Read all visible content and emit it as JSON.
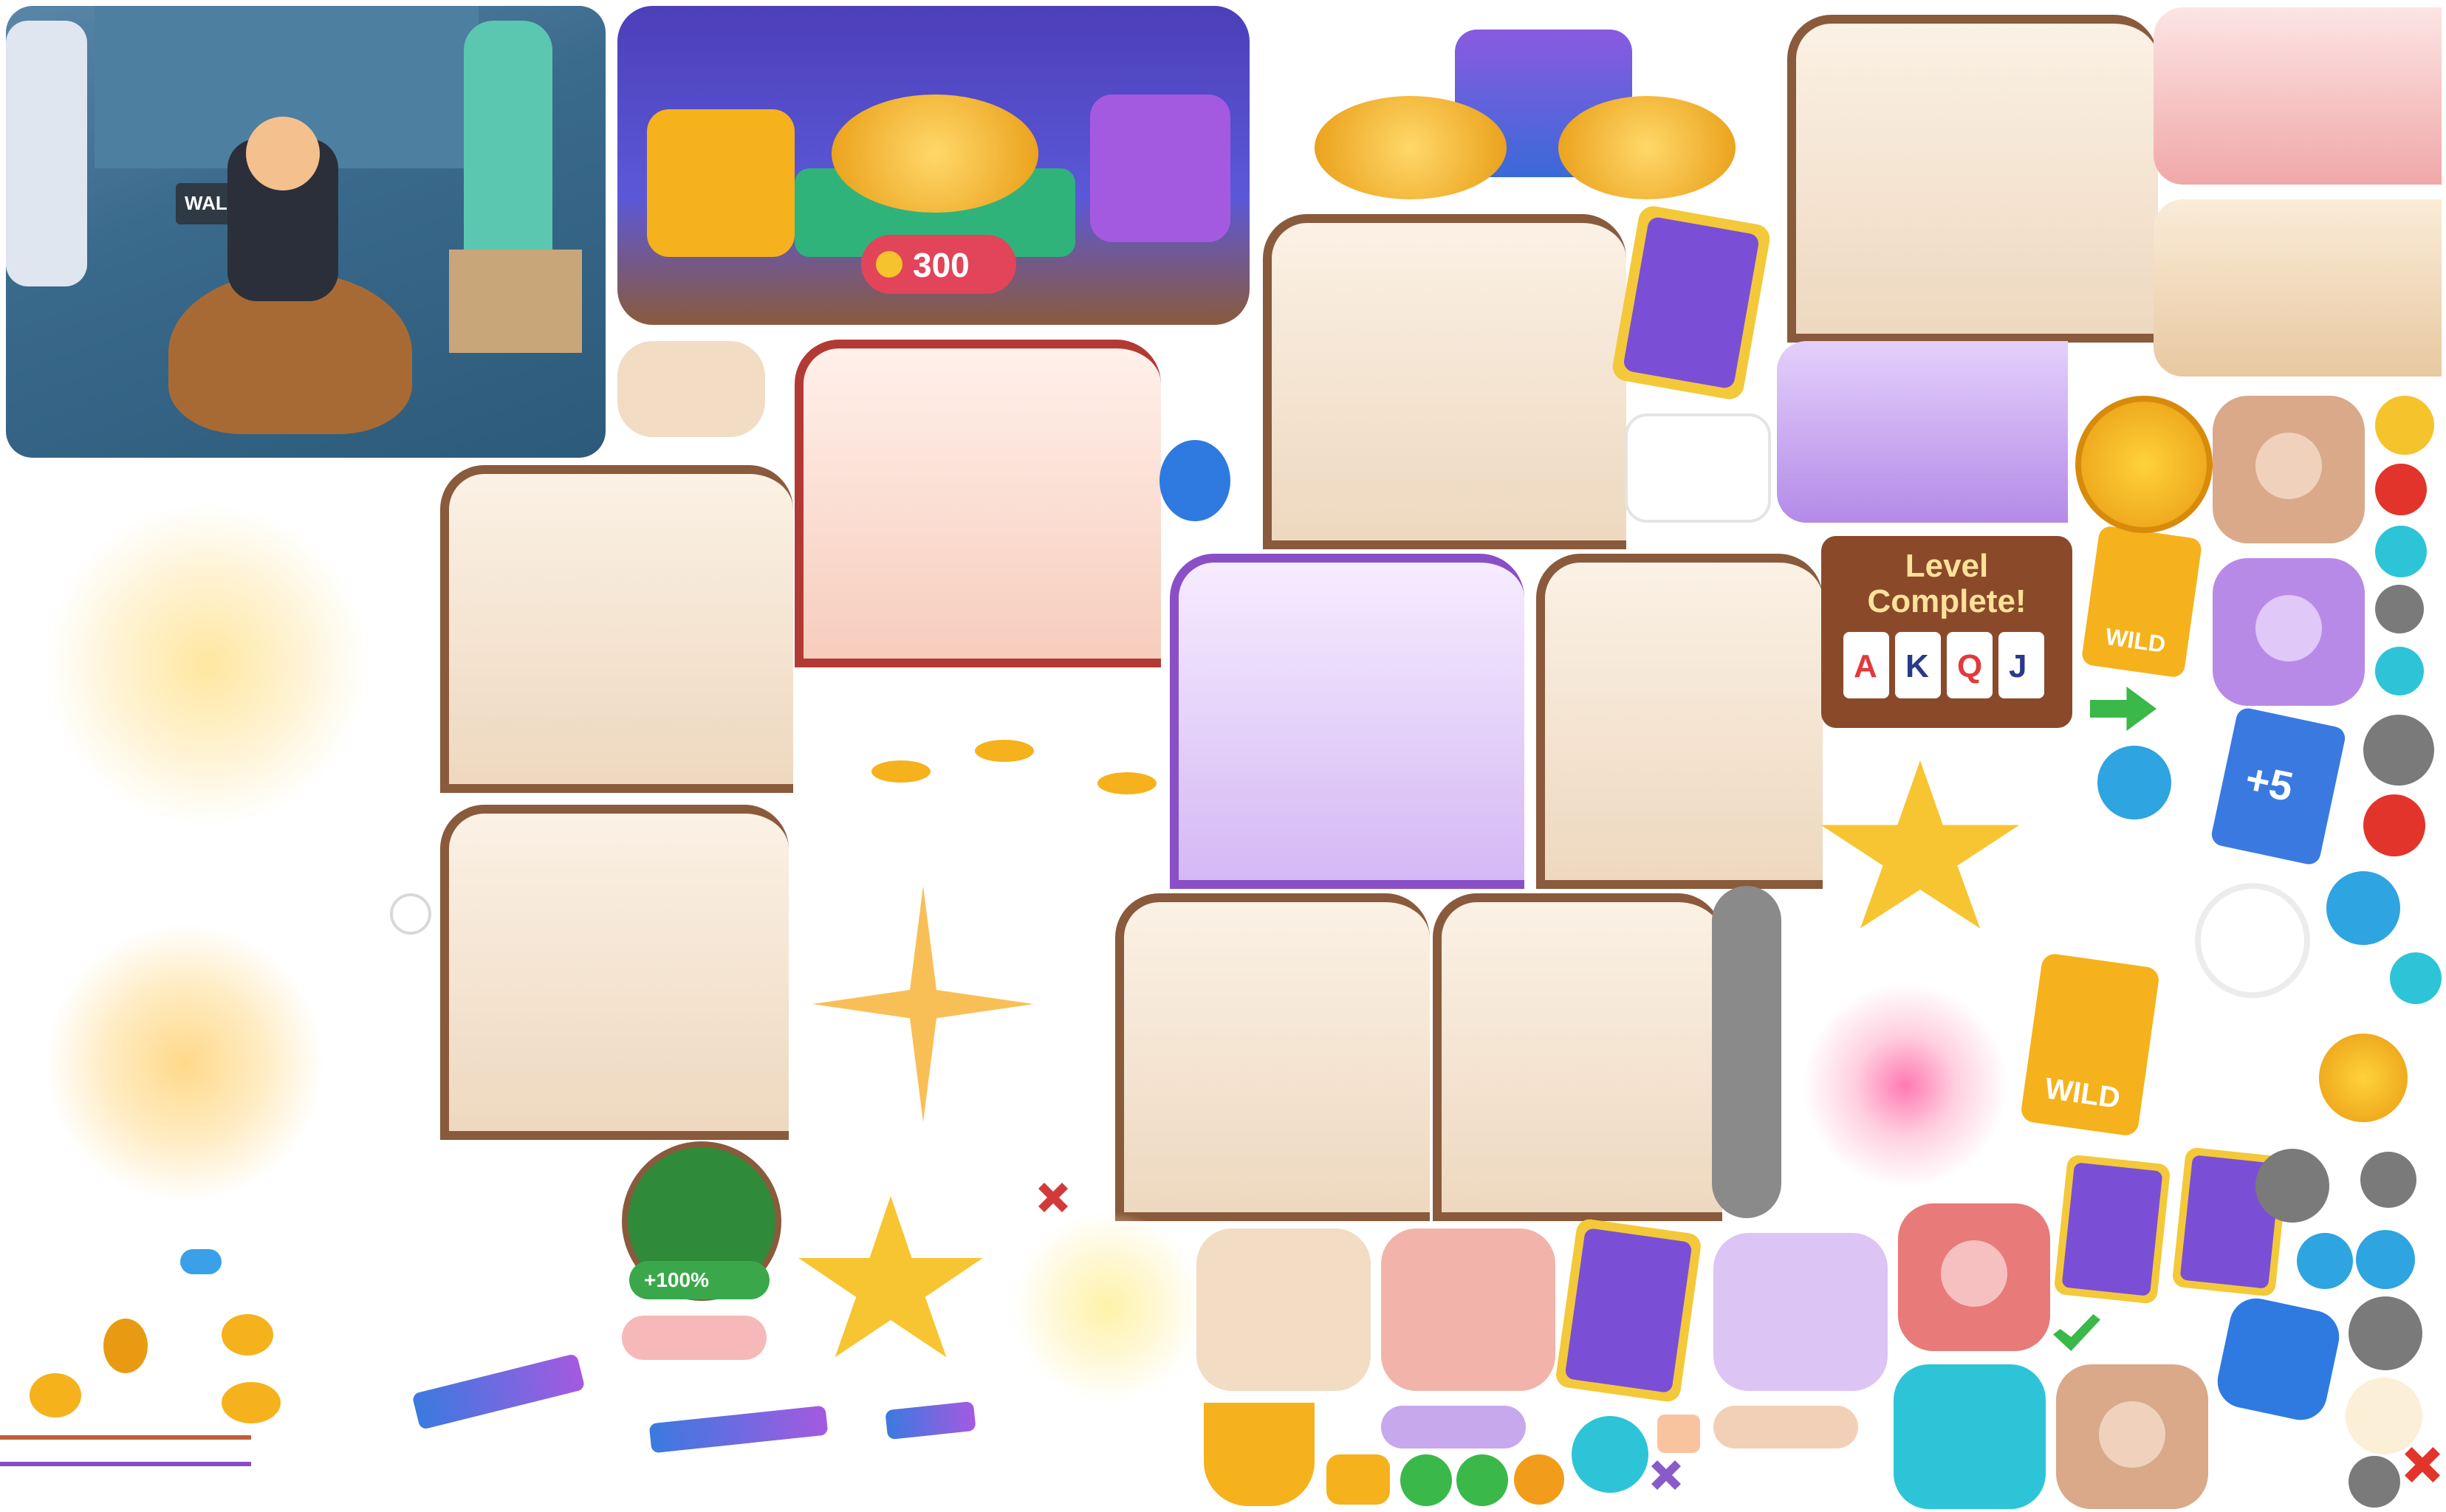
{
  "sheet": {
    "background": "#ffffff",
    "accent_gold": "#f5b21c",
    "panel_cream": "#f8ead9",
    "panel_brown_border": "#8a5a3c",
    "panel_red_border": "#b23a34",
    "panel_purple_border": "#8a4fc6"
  },
  "banners": {
    "coin_reward_value": "300",
    "street_sign": "WALL"
  },
  "level_complete": {
    "line1": "Level",
    "line2": "Complete!",
    "cards": [
      "A",
      "K",
      "Q",
      "J"
    ]
  },
  "cards": {
    "wild_label": "WILD",
    "plus_five_label": "+5"
  },
  "video_badge": {
    "bonus_label": "+100%"
  },
  "icons": [
    "heart-coin-icon",
    "lock-icon",
    "music-note-icon",
    "music-off-icon",
    "power-icon",
    "sound-on-icon",
    "sound-off-icon",
    "vibrate-icon",
    "vibrate-off-icon",
    "gear-icon",
    "undo-arrow-icon",
    "checkmark-icon",
    "close-x-icon",
    "play-icon",
    "plus-icon",
    "trophy-icon",
    "star-icon",
    "green-arrow-icon",
    "chat-bubble-icon",
    "heart-outline-icon"
  ]
}
